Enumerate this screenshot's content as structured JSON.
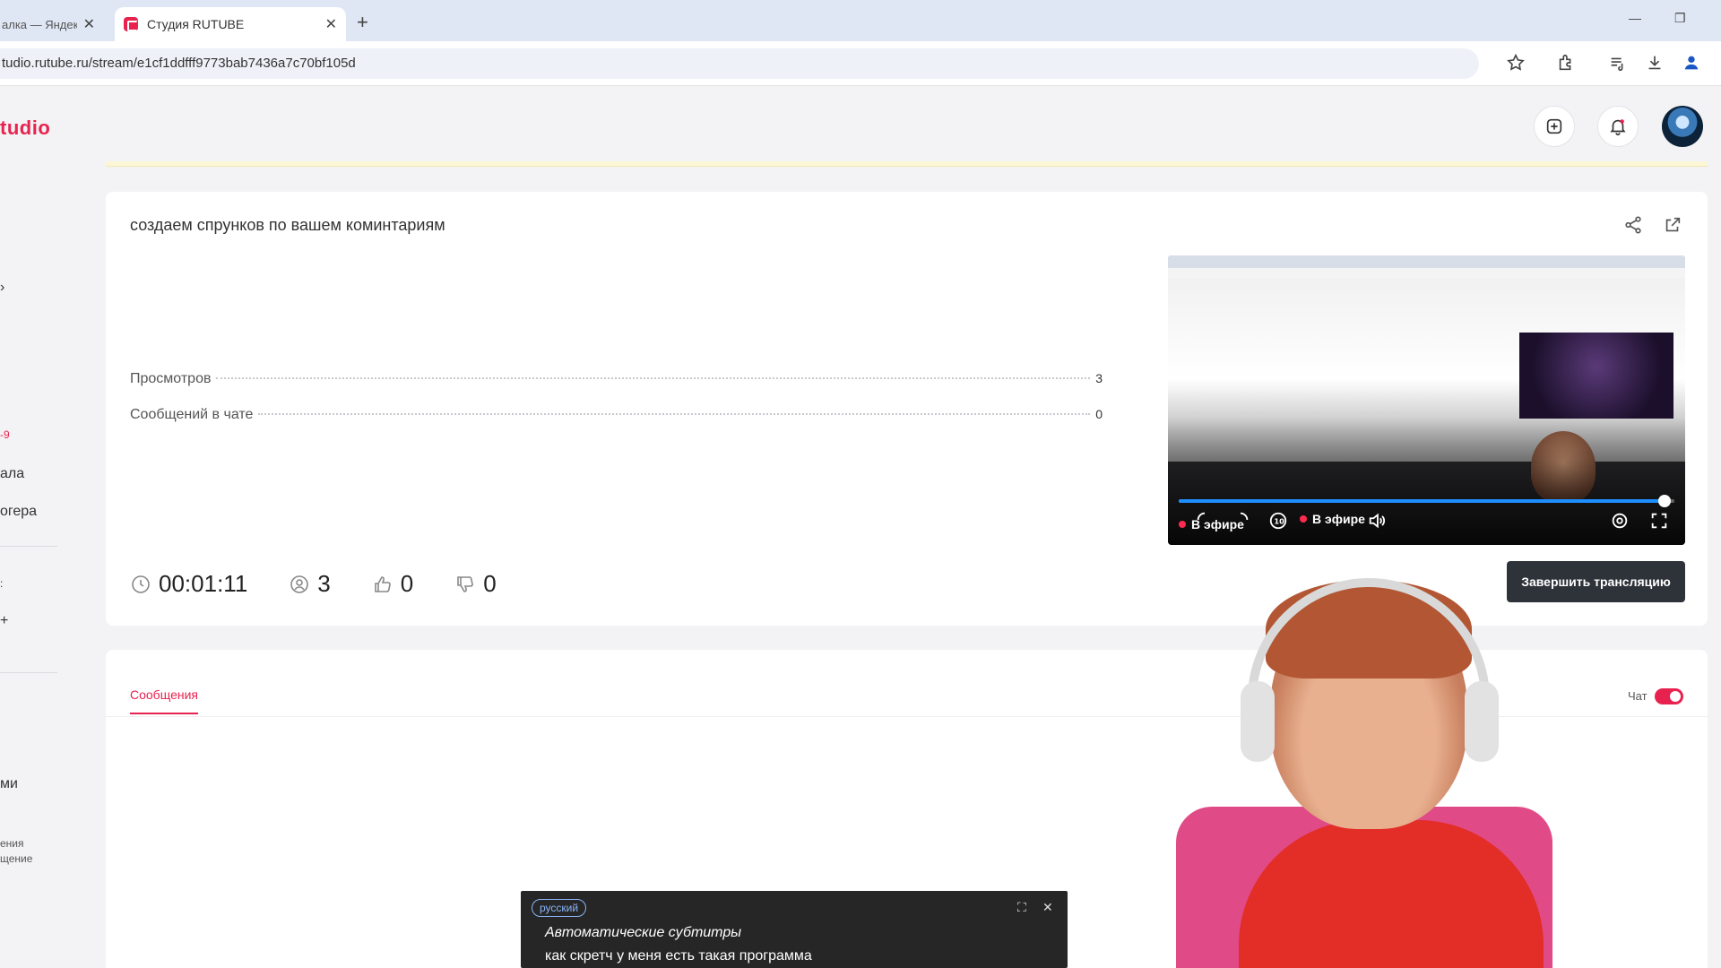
{
  "browser": {
    "tabs": [
      {
        "title": "алка — Яндекс",
        "active": false
      },
      {
        "title": "Студия RUTUBE",
        "active": true
      }
    ],
    "url": "tudio.rutube.ru/stream/e1cf1ddfff9773bab7436a7c70bf105d"
  },
  "app": {
    "logo": "tudio"
  },
  "sidebar": {
    "items": [
      "ала",
      "огера",
      "ми",
      "ения",
      "щение"
    ],
    "add_label": "+",
    "red_text": "-9"
  },
  "stream": {
    "title": "создаем спрунков по вашем коминтариям",
    "stats": [
      {
        "label": "Просмотров",
        "value": "3"
      },
      {
        "label": "Сообщений в чате",
        "value": "0"
      }
    ],
    "metrics": {
      "duration": "00:01:11",
      "viewers": "3",
      "likes": "0",
      "dislikes": "0"
    },
    "player": {
      "live_label_1": "В эфире",
      "live_label_2": "В эфире",
      "progress": 0.98
    },
    "end_button": "Завершить трансляцию"
  },
  "messages": {
    "tab_label": "Сообщения",
    "chat_label": "Чат",
    "chat_enabled": true
  },
  "captions": {
    "language": "русский",
    "title": "Автоматические субтитры",
    "text": "как скретч у меня есть такая программа"
  },
  "colors": {
    "brand": "#e8224f",
    "player_accent": "#1e8fff",
    "end_button_bg": "#2e333a"
  }
}
